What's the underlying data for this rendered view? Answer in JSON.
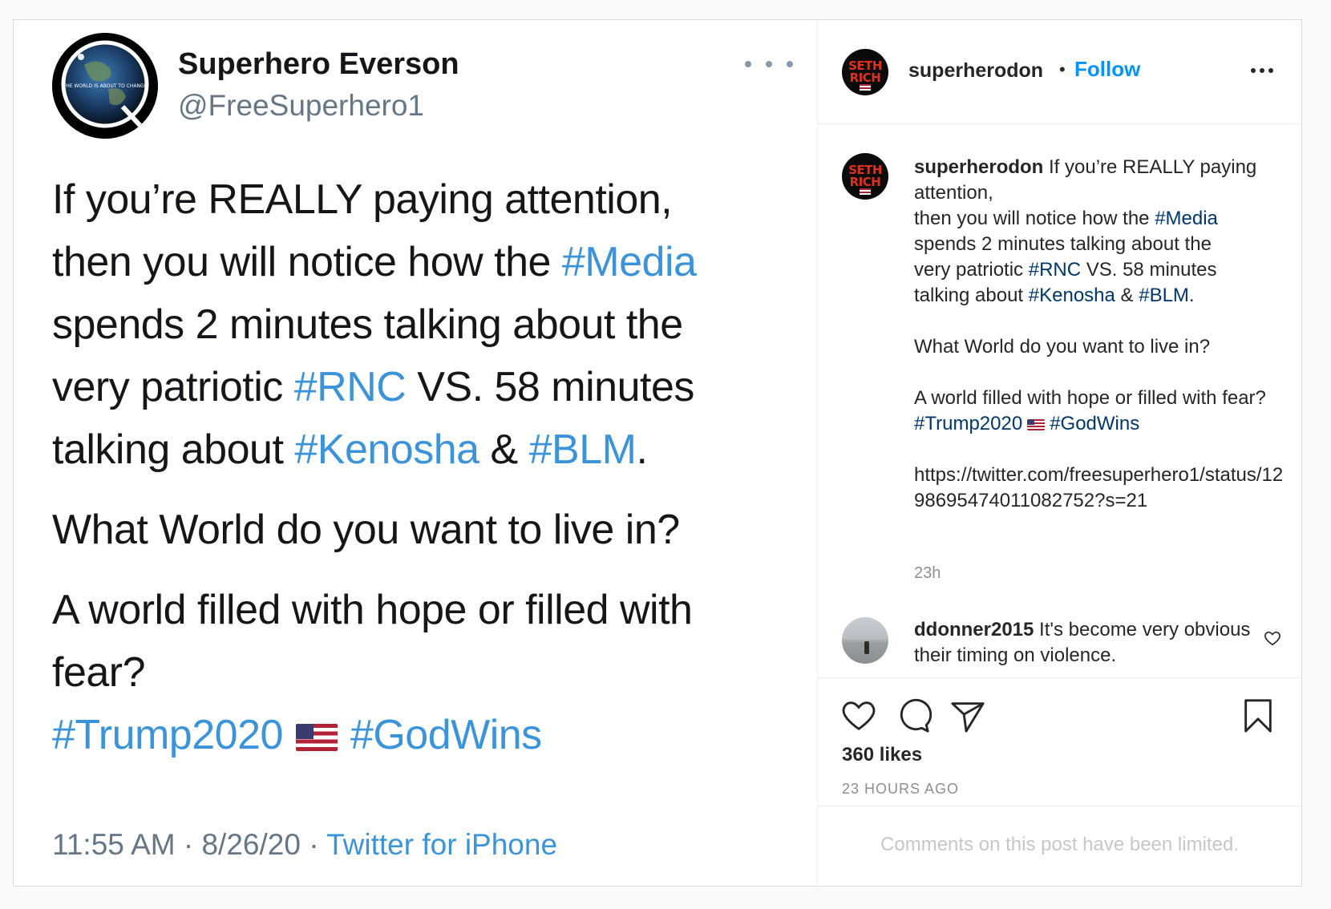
{
  "tweet": {
    "name": "Superhero Everson",
    "handle": "@FreeSuperhero1",
    "avatar_label": "THE WORLD IS ABOUT TO CHANGE",
    "line1": "If you’re REALLY paying attention,",
    "line2_pre": "then you will notice how the ",
    "line2_tag": "#Media",
    "line3": "spends 2 minutes talking about the",
    "line4_pre": "very patriotic ",
    "line4_tag": "#RNC",
    "line4_post": " VS. 58 minutes",
    "line5_pre": "talking about ",
    "line5_tag1": "#Kenosha",
    "line5_amp": " & ",
    "line5_tag2": "#BLM",
    "line5_end": ".",
    "line6": "What World do you want to live in?",
    "line7": "A world filled with hope or filled with",
    "line8": "fear?",
    "tag_trump": "#Trump2020",
    "tag_god": "#GodWins",
    "meta_time": "11:55 AM · 8/26/20 · ",
    "meta_source": "Twitter for iPhone"
  },
  "panel": {
    "username": "superherodon",
    "dot": "•",
    "follow": "Follow",
    "avatar_text": "SETH RICH",
    "caption": {
      "user": "superherodon",
      "l1": " If you’re REALLY paying attention,",
      "l2_pre": "then you will notice how the ",
      "l2_tag": "#Media",
      "l3": "spends 2 minutes talking about the",
      "l4_pre": "very patriotic ",
      "l4_tag": "#RNC",
      "l4_post": " VS. 58 minutes",
      "l5_pre": "talking about ",
      "l5_tag1": "#Kenosha",
      "l5_amp": " & ",
      "l5_tag2": "#BLM",
      "l5_end": ".",
      "l6": "What World do you want to live in?",
      "l7": "A world filled with hope or filled with fear?",
      "tag_trump": "#Trump2020",
      "tag_god": "#GodWins",
      "url": "https://twitter.com/freesuperhero1/status/1298695474011082752?s=21"
    },
    "time_ago": "23h",
    "comment": {
      "user": "ddonner2015",
      "text": " It's become very obvious their timing on violence."
    },
    "likes": "360 likes",
    "ago_caps": "23 HOURS AGO",
    "limited": "Comments on this post have been limited."
  },
  "colors": {
    "twitter_link": "#3b94d9",
    "ig_link": "#00376b",
    "follow_blue": "#0095f6"
  }
}
